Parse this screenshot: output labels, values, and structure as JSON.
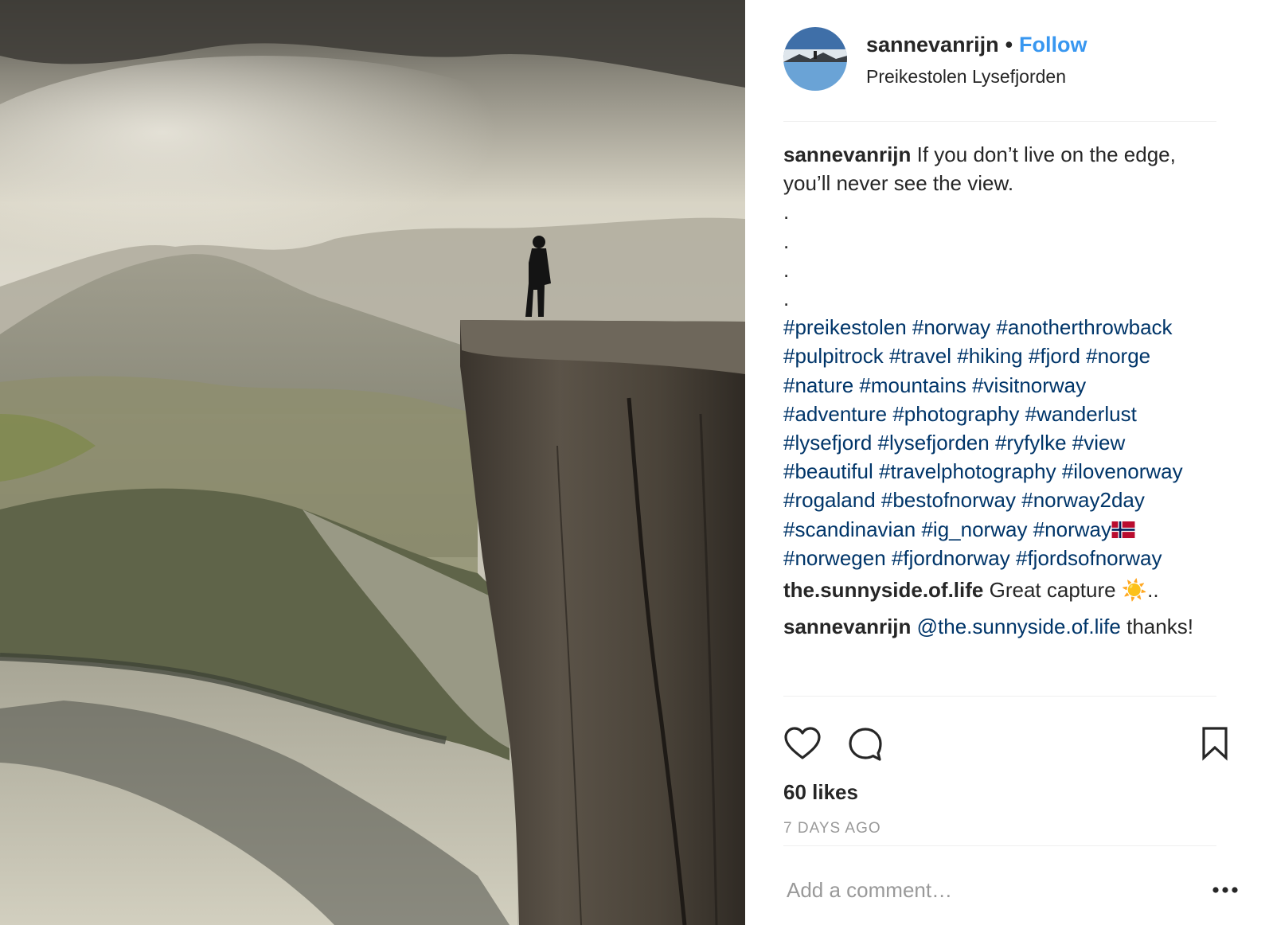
{
  "post": {
    "username": "sannevanrijn",
    "separator": "•",
    "follow_label": "Follow",
    "location": "Preikestolen Lysefjorden"
  },
  "caption": {
    "username": "sannevanrijn",
    "text": "If you don’t live on the edge, you’ll never see the view.",
    "dots": [
      ".",
      ".",
      ".",
      "."
    ],
    "hashtags": [
      "#preikestolen",
      "#norway",
      "#anotherthrowback",
      "#pulpitrock",
      "#travel",
      "#hiking",
      "#fjord",
      "#norge",
      "#nature",
      "#mountains",
      "#visitnorway",
      "#adventure",
      "#photography",
      "#wanderlust",
      "#lysefjord",
      "#lysefjorden",
      "#ryfylke",
      "#view",
      "#beautiful",
      "#travelphotography",
      "#ilovenorway",
      "#rogaland",
      "#bestofnorway",
      "#norway2day",
      "#scandinavian",
      "#ig_norway",
      "#norway",
      "#norwegen",
      "#fjordnorway",
      "#fjordsofnorway"
    ]
  },
  "comments": [
    {
      "username": "the.sunnyside.of.life",
      "text": "Great capture ☀️.."
    },
    {
      "username": "sannevanrijn",
      "mention": "@the.sunnyside.of.life",
      "text": "thanks!"
    }
  ],
  "stats": {
    "likes": "60 likes",
    "time_ago": "7 DAYS AGO"
  },
  "composer": {
    "placeholder": "Add a comment…"
  },
  "icons": {
    "like": "heart-icon",
    "comment": "comment-bubble-icon",
    "save": "bookmark-icon",
    "more": "more-options-icon"
  }
}
